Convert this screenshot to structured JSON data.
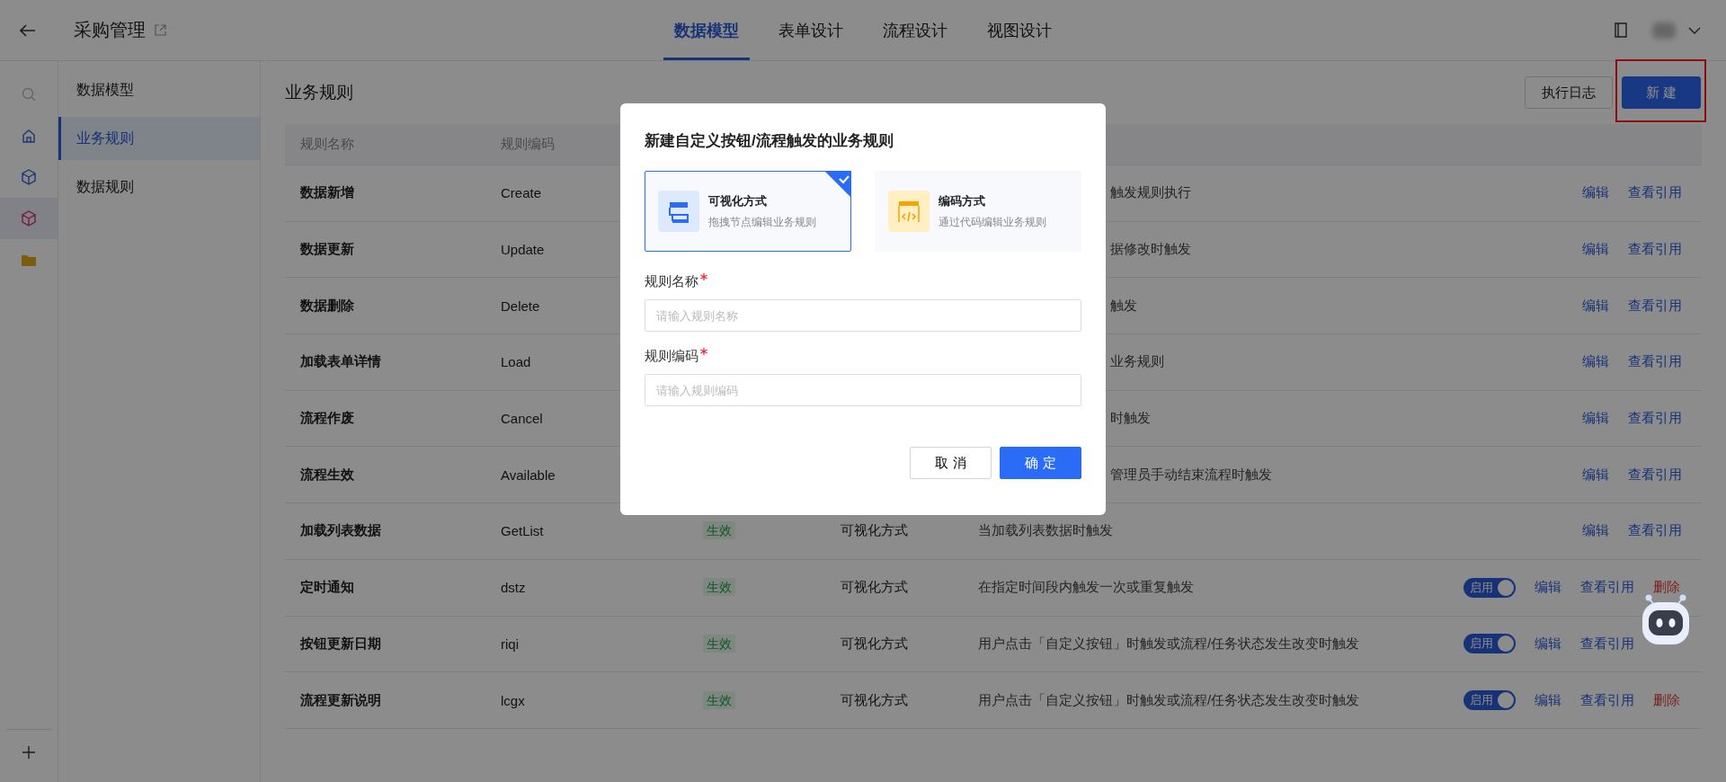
{
  "app": {
    "title": "采购管理"
  },
  "top_tabs": [
    {
      "label": "数据模型",
      "selected": true
    },
    {
      "label": "表单设计",
      "selected": false
    },
    {
      "label": "流程设计",
      "selected": false
    },
    {
      "label": "视图设计",
      "selected": false
    }
  ],
  "rail": [
    {
      "kind": "search",
      "selected": false
    },
    {
      "kind": "home",
      "selected": false
    },
    {
      "kind": "cube",
      "selected": false
    },
    {
      "kind": "cube",
      "selected": true
    },
    {
      "kind": "folder",
      "selected": false
    }
  ],
  "sidebar": {
    "items": [
      {
        "label": "数据模型",
        "selected": false
      },
      {
        "label": "业务规则",
        "selected": true
      },
      {
        "label": "数据规则",
        "selected": false
      }
    ]
  },
  "page": {
    "title": "业务规则",
    "actions": [
      {
        "label": "执行日志",
        "kind": "default",
        "highlighted": false
      },
      {
        "label": "新 建",
        "kind": "primary",
        "highlighted": true
      }
    ]
  },
  "table": {
    "columns": [
      "规则名称",
      "规则编码"
    ],
    "rows": [
      {
        "name": "数据新增",
        "code": "Create",
        "description": "触发规则执行",
        "actions": [
          {
            "label": "编辑",
            "kind": "link"
          },
          {
            "label": "查看引用",
            "kind": "link"
          }
        ]
      },
      {
        "name": "数据更新",
        "code": "Update",
        "description": "据修改时触发",
        "actions": [
          {
            "label": "编辑",
            "kind": "link"
          },
          {
            "label": "查看引用",
            "kind": "link"
          }
        ]
      },
      {
        "name": "数据删除",
        "code": "Delete",
        "description": "触发",
        "actions": [
          {
            "label": "编辑",
            "kind": "link"
          },
          {
            "label": "查看引用",
            "kind": "link"
          }
        ]
      },
      {
        "name": "加载表单详情",
        "code": "Load",
        "description": "业务规则",
        "actions": [
          {
            "label": "编辑",
            "kind": "link"
          },
          {
            "label": "查看引用",
            "kind": "link"
          }
        ]
      },
      {
        "name": "流程作废",
        "code": "Cancel",
        "description": "时触发",
        "actions": [
          {
            "label": "编辑",
            "kind": "link"
          },
          {
            "label": "查看引用",
            "kind": "link"
          }
        ]
      },
      {
        "name": "流程生效",
        "code": "Available",
        "description": "管理员手动结束流程时触发",
        "actions": [
          {
            "label": "编辑",
            "kind": "link"
          },
          {
            "label": "查看引用",
            "kind": "link"
          }
        ]
      },
      {
        "name": "加载列表数据",
        "code": "GetList",
        "status": "生效",
        "method": "可视化方式",
        "description": "当加载列表数据时触发",
        "actions": [
          {
            "label": "编辑",
            "kind": "link"
          },
          {
            "label": "查看引用",
            "kind": "link"
          }
        ]
      },
      {
        "name": "定时通知",
        "code": "dstz",
        "status": "生效",
        "method": "可视化方式",
        "description": "在指定时间段内触发一次或重复触发",
        "toggle": {
          "label": "启用",
          "on": true
        },
        "actions": [
          {
            "label": "编辑",
            "kind": "link"
          },
          {
            "label": "查看引用",
            "kind": "link"
          },
          {
            "label": "删除",
            "kind": "danger"
          }
        ]
      },
      {
        "name": "按钮更新日期",
        "code": "riqi",
        "status": "生效",
        "method": "可视化方式",
        "description": "用户点击「自定义按钮」时触发或流程/任务状态发生改变时触发",
        "toggle": {
          "label": "启用",
          "on": true
        },
        "actions": [
          {
            "label": "编辑",
            "kind": "link"
          },
          {
            "label": "查看引用",
            "kind": "link"
          }
        ]
      },
      {
        "name": "流程更新说明",
        "code": "lcgx",
        "status": "生效",
        "method": "可视化方式",
        "description": "用户点击「自定义按钮」时触发或流程/任务状态发生改变时触发",
        "toggle": {
          "label": "启用",
          "on": true
        },
        "actions": [
          {
            "label": "编辑",
            "kind": "link"
          },
          {
            "label": "查看引用",
            "kind": "link"
          },
          {
            "label": "删除",
            "kind": "danger"
          }
        ]
      }
    ]
  },
  "dialog": {
    "title": "新建自定义按钮/流程触发的业务规则",
    "modes": [
      {
        "kind": "visual",
        "title": "可视化方式",
        "subtitle": "拖拽节点编辑业务规则",
        "selected": true
      },
      {
        "kind": "code",
        "title": "编码方式",
        "subtitle": "通过代码编辑业务规则",
        "selected": false
      }
    ],
    "fields": [
      {
        "label": "规则名称",
        "required": true,
        "placeholder": "请输入规则名称"
      },
      {
        "label": "规则编码",
        "required": true,
        "placeholder": "请输入规则编码"
      }
    ],
    "buttons": [
      {
        "label": "取 消",
        "kind": "default"
      },
      {
        "label": "确 定",
        "kind": "primary"
      }
    ]
  }
}
